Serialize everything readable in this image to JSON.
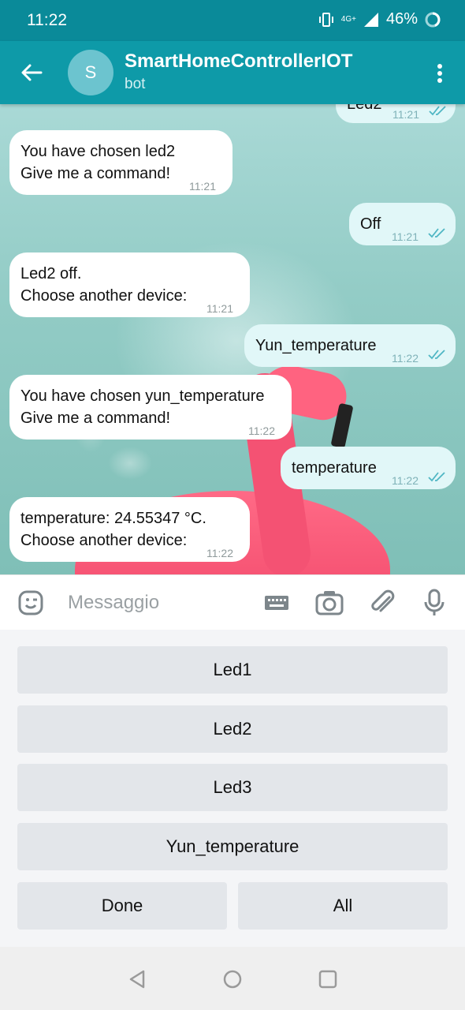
{
  "status_bar": {
    "time": "11:22",
    "network": "4G+",
    "battery": "46%"
  },
  "header": {
    "avatar_initial": "S",
    "title": "SmartHomeControllerIOT",
    "subtitle": "bot"
  },
  "messages": [
    {
      "dir": "out",
      "text": "Led2",
      "time": "11:21",
      "read": true
    },
    {
      "dir": "in",
      "lines": [
        "You have chosen led2",
        "Give me a command!"
      ],
      "time": "11:21"
    },
    {
      "dir": "out",
      "text": "Off",
      "time": "11:21",
      "read": true
    },
    {
      "dir": "in",
      "lines": [
        "Led2 off.",
        "Choose another device:"
      ],
      "time": "11:21"
    },
    {
      "dir": "out",
      "text": "Yun_temperature",
      "time": "11:22",
      "read": true
    },
    {
      "dir": "in",
      "lines": [
        "You have chosen yun_temperature",
        "Give me a command!"
      ],
      "time": "11:22"
    },
    {
      "dir": "out",
      "text": "temperature",
      "time": "11:22",
      "read": true
    },
    {
      "dir": "in",
      "lines": [
        "temperature: 24.55347 °C.",
        "Choose another device:"
      ],
      "time": "11:22"
    }
  ],
  "input": {
    "placeholder": "Messaggio"
  },
  "keyboard": {
    "buttons": [
      "Led1",
      "Led2",
      "Led3",
      "Yun_temperature",
      "Done",
      "All"
    ]
  },
  "colors": {
    "header": "#0e9aa8",
    "status_bar": "#0a8a99",
    "outgoing_bubble": "#e1f7f8",
    "incoming_bubble": "#ffffff"
  }
}
